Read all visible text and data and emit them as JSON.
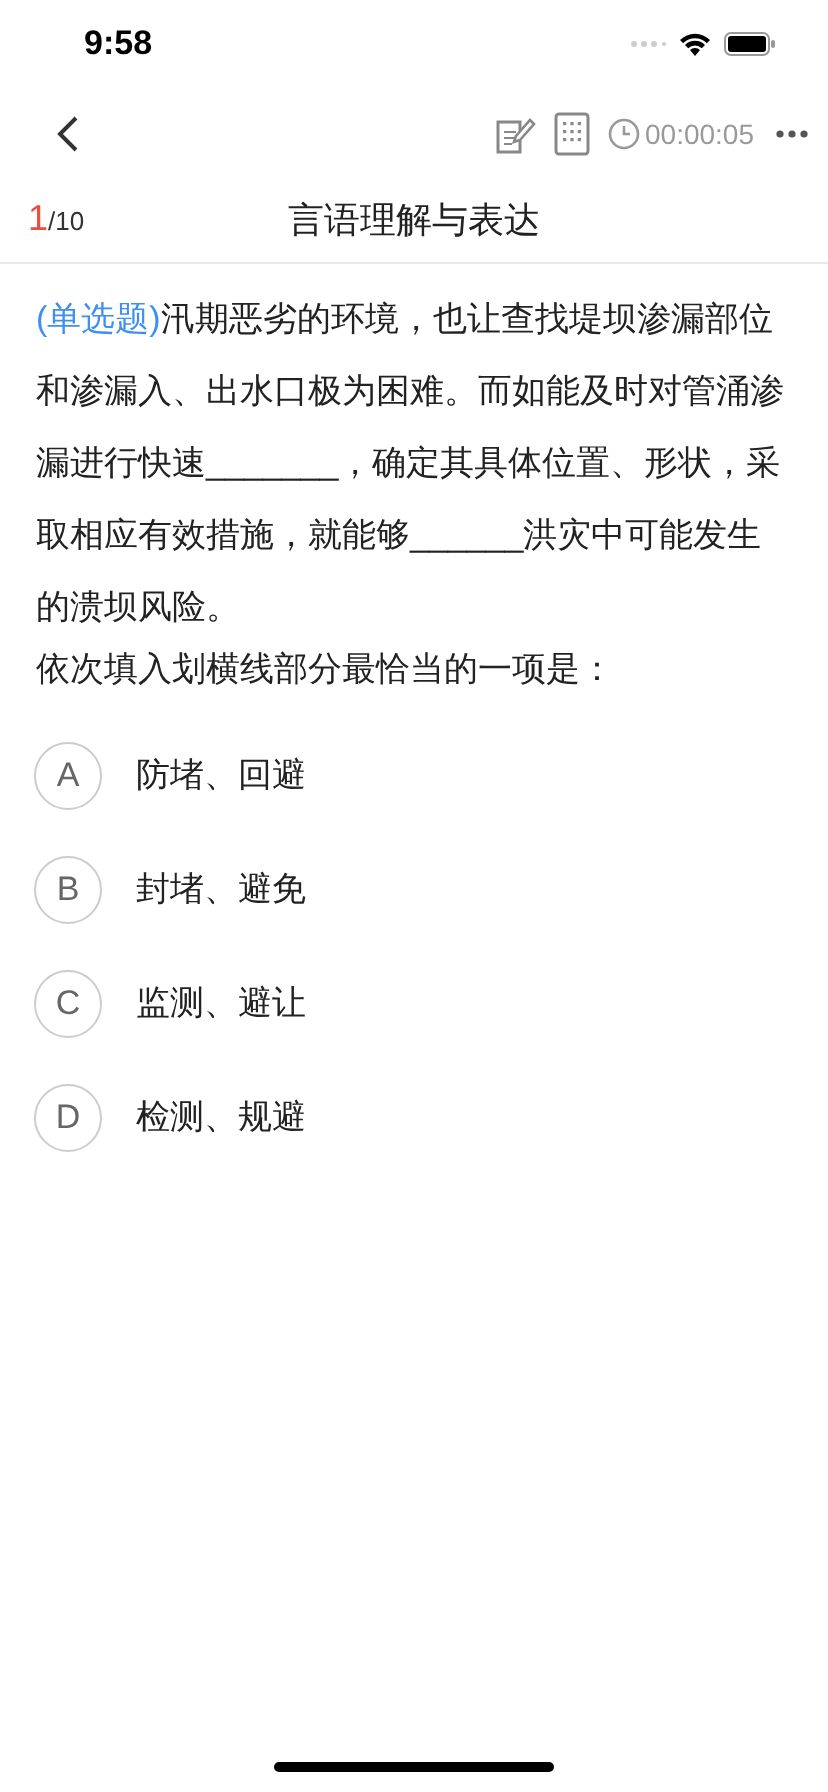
{
  "status_bar": {
    "time": "9:58"
  },
  "nav": {
    "timer": "00:00:05"
  },
  "header": {
    "current": "1",
    "total": "/10",
    "title": "言语理解与表达"
  },
  "question": {
    "type_tag": "(单选题)",
    "stem": "汛期恶劣的环境，也让查找堤坝渗漏部位和渗漏入、出水口极为困难。而如能及时对管涌渗漏进行快速_______，确定其具体位置、形状，采取相应有效措施，就能够______洪灾中可能发生的溃坝风险。",
    "prompt": "依次填入划横线部分最恰当的一项是："
  },
  "options": [
    {
      "letter": "A",
      "text": "防堵、回避",
      "selected": false
    },
    {
      "letter": "B",
      "text": "封堵、避免",
      "selected": false
    },
    {
      "letter": "C",
      "text": "监测、避让",
      "selected": false
    },
    {
      "letter": "D",
      "text": "检测、规避",
      "selected": false
    }
  ]
}
